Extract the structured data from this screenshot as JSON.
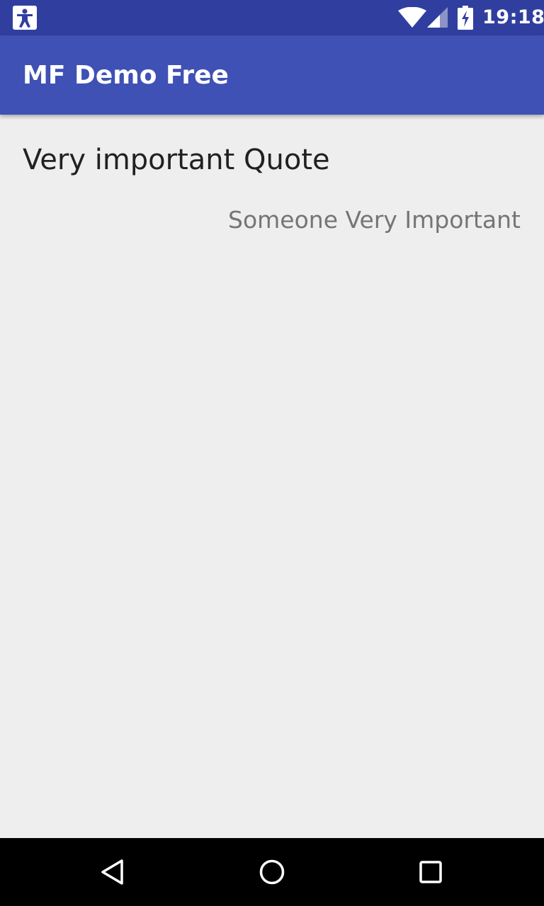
{
  "status_bar": {
    "time": "19:18",
    "icons": [
      "accessibility-icon",
      "wifi-icon",
      "signal-icon",
      "battery-charging-icon"
    ],
    "background_color": "#303f9f"
  },
  "app_bar": {
    "title": "MF Demo Free",
    "background_color": "#3f51b5"
  },
  "content": {
    "quote": "Very important Quote",
    "author": "Someone Very Important",
    "background_color": "#eeeeee"
  },
  "nav_bar": {
    "buttons": [
      "back-icon",
      "home-icon",
      "recents-icon"
    ]
  }
}
